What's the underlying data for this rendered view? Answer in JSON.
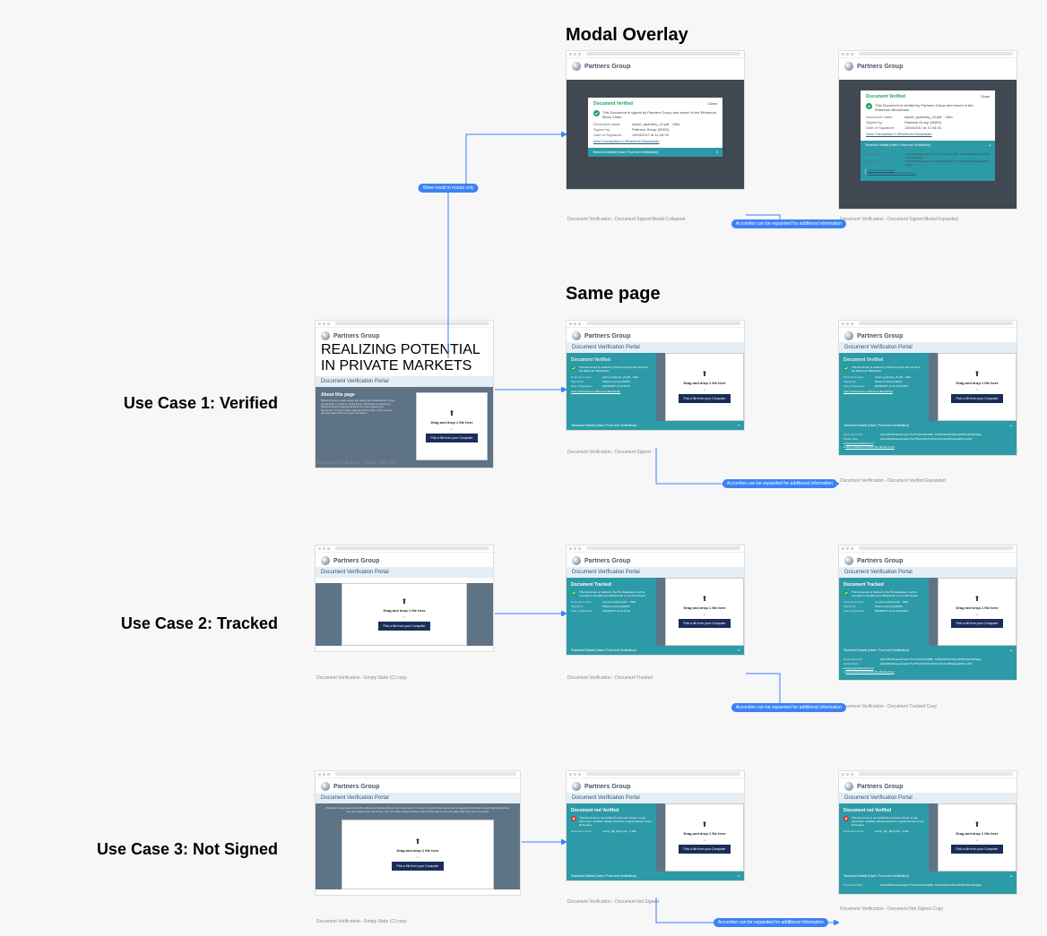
{
  "headings": {
    "modal_overlay": "Modal Overlay",
    "same_page": "Same page"
  },
  "usecases": {
    "uc1": "Use Case 1: Verified",
    "uc2": "Use Case 2: Tracked",
    "uc3": "Use Case 3: Not Signed"
  },
  "brand": {
    "name": "Partners Group",
    "tagline": "REALIZING POTENTIAL IN PRIVATE MARKETS"
  },
  "portal_title": "Document Verification Portal",
  "about": {
    "title": "About this page",
    "text": "Partners Group cares about the safety and authenticity of your documents. In order to verify if your document is signed by Partners Group Signing Service you can upload your document. You can either drag and drop 1 file in this area or you can pick a file from your computer."
  },
  "intro_centered": "Partners Group cares about the safety and authenticity of your documents. In order to verify if your document is signed by Partners Group Signing Service, you can upload your document. You can either drag and drop 1 file in this area or you can pick a file from your computer.",
  "dropzone": {
    "main": "Drag and drop 1 file here",
    "or": "or",
    "button": "Pick a file from your Computer"
  },
  "captions": {
    "empty_state": "Document Verification - Empty State (E)",
    "empty_centered": "Document Verification - Empty State (C) copy",
    "modal_collapsed": "Document Verification - Document Signed Modal Collapsed",
    "modal_expanded": "Document Verification - Document Signed Modal Expanded",
    "same_signed": "Document Verification - Document Signed",
    "same_signed_exp": "Document Verification - Document Verified Expanded",
    "tracked": "Document Verification - Document Tracked",
    "tracked_exp": "Document Verification - Document Tracked Copy",
    "not_signed": "Document Verification - Document Not Signed",
    "not_signed_exp": "Document Verification - Document Not Signed Copy",
    "empty_centered2": "Document Verification - Empty State (C) copy"
  },
  "results": {
    "verified": {
      "title": "Document Verified",
      "msg": "This Document is signed by Partners Group and stored in the Ethereum Block Chain."
    },
    "verified_alt": {
      "msg": "This Document is verified by Partners Group and stored in the Ethereum Blockchain."
    },
    "tracked": {
      "title": "Document Tracked",
      "msg": "This Document is tracked in the PG Database. It will be recorded in the Ethereum Blockchain in 3 to 25 minutes."
    },
    "not_verified": {
      "title": "Document not Verified",
      "msg": "This Document is not verified by Partners Group. It may have been modified. Please check the original Version of the Document."
    }
  },
  "meta": {
    "labels": {
      "doc_name": "Document name:",
      "signed_by": "Signed by:",
      "date_sig": "Date of Signature:",
      "date_sig_alt": "Date of Signature",
      "doc_hash": "Document hash:",
      "merkle": "Merkle Root:"
    },
    "values": {
      "doc": "report_quarterly_v3.pdf   ·   13kb",
      "doc2": "my-pvt-contract.pptm   ·   32kb",
      "doc3": "server_file_38.3.pptx   ·   2.2kb",
      "signer": "Partners Group (WW3)",
      "date": "13/04/2017 at 11:44:33",
      "date2": "05/08/2017 at 11:44:23:35:4",
      "hash": "ab52d4615baae221e2c77e7b13ea3ef298d.fe9424ab52d487ee258dfe97eb94gap",
      "merkle_hash": "ab42d8618baaee21e2e77e7f8e439a637e6313ac6b4a2583gbee98fnoa397"
    }
  },
  "links": {
    "view_tx": "View Transaction in Ethereum Blockchain",
    "dl_merkle": "Download Merkle Proof",
    "how_verify": "How to Read and Verify the Merkle Proof"
  },
  "accordion": {
    "label": "Technical Details (Hash, Proof and Verification)",
    "chev_down": "▾",
    "chev_up": "▴"
  },
  "modal": {
    "close": "Close"
  },
  "pills": {
    "modal_branch": "Show result in modal only",
    "accordion_note": "Accordion can be expanded for additional information"
  }
}
